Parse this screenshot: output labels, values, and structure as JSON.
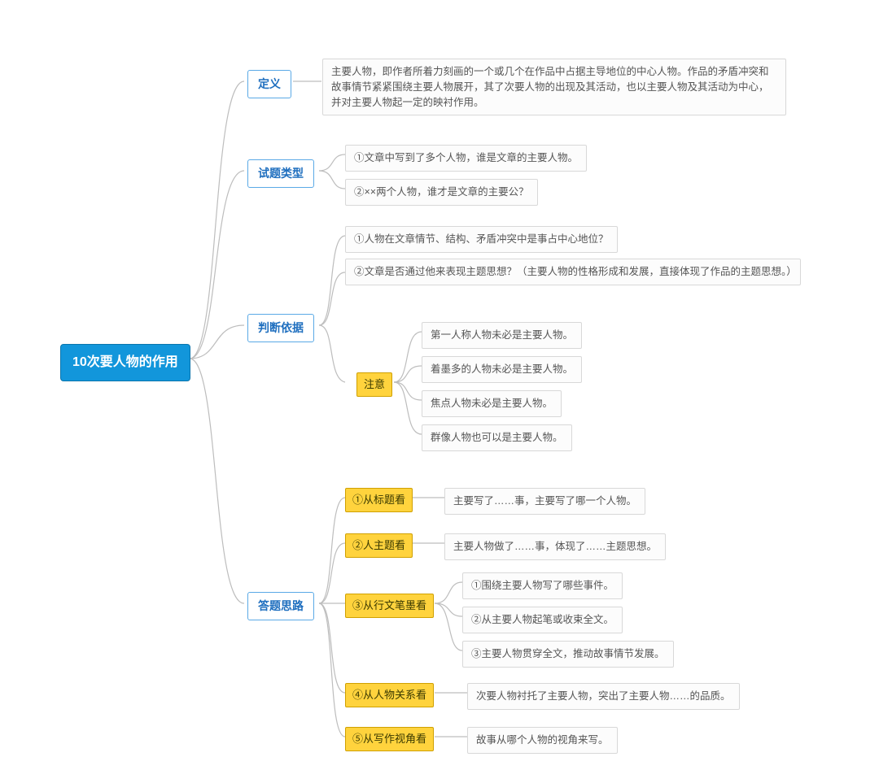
{
  "root": {
    "label": "10次要人物的作用"
  },
  "b1": {
    "definition": {
      "label": "定义"
    },
    "types": {
      "label": "试题类型"
    },
    "criteria": {
      "label": "判断依据"
    },
    "approach": {
      "label": "答题思路"
    }
  },
  "definition_text": "主要人物，即作者所着力刻画的一个或几个在作品中占据主导地位的中心人物。作品的矛盾冲突和故事情节紧紧围绕主要人物展开，其了次要人物的出现及其活动，也以主要人物及其活动为中心，并对主要人物起一定的映衬作用。",
  "types": {
    "t1": "①文章中写到了多个人物，谁是文章的主要人物。",
    "t2": "②××两个人物，谁才是文章的主要公？"
  },
  "criteria": {
    "c1": "①人物在文章情节、结构、矛盾冲突中是事占中心地位？",
    "c2": "②文章是否通过他来表现主题思想？（主要人物的性格形成和发展，直接体现了作品的主题思想。）",
    "note_label": "注意",
    "notes": {
      "n1": "第一人称人物未必是主要人物。",
      "n2": "着墨多的人物未必是主要人物。",
      "n3": "焦点人物未必是主要人物。",
      "n4": "群像人物也可以是主要人物。"
    }
  },
  "approach": {
    "a1": {
      "label": "①从标题看",
      "text": "主要写了……事，主要写了哪一个人物。"
    },
    "a2": {
      "label": "②人主题看",
      "text": "主要人物做了……事，体现了……主题思想。"
    },
    "a3": {
      "label": "③从行文笔墨看",
      "items": {
        "i1": "①围绕主要人物写了哪些事件。",
        "i2": "②从主要人物起笔或收束全文。",
        "i3": "③主要人物贯穿全文，推动故事情节发展。"
      }
    },
    "a4": {
      "label": "④从人物关系看",
      "text": "次要人物衬托了主要人物，突出了主要人物……的品质。"
    },
    "a5": {
      "label": "⑤从写作视角看",
      "text": "故事从哪个人物的视角来写。"
    }
  }
}
